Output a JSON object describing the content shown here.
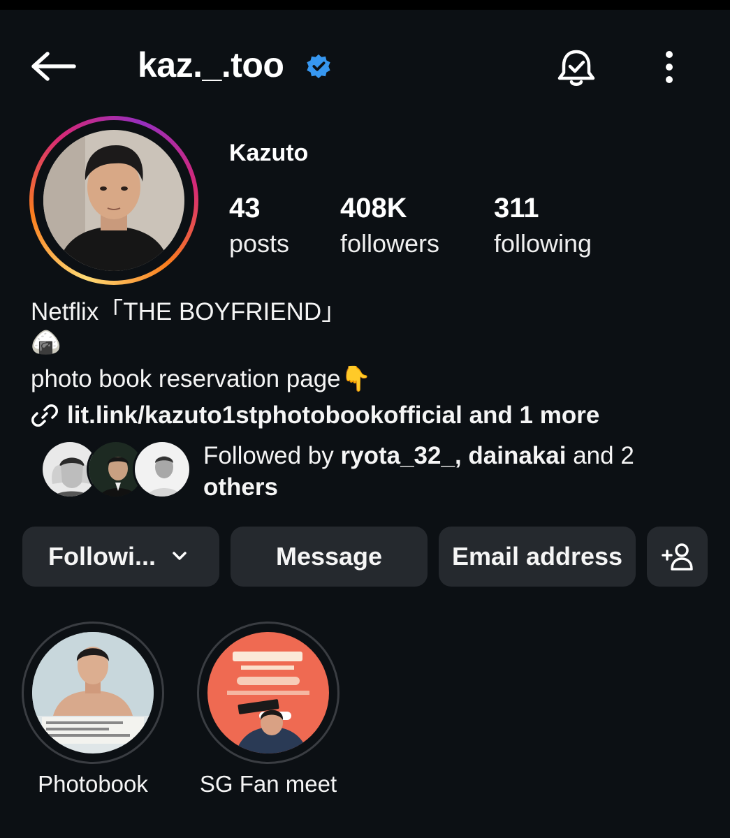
{
  "header": {
    "username": "kaz._.too"
  },
  "profile": {
    "display_name": "Kazuto",
    "stats": [
      {
        "value": "43",
        "label": "posts"
      },
      {
        "value": "408K",
        "label": "followers"
      },
      {
        "value": "311",
        "label": "following"
      }
    ],
    "bio_line1": "Netflix「THE BOYFRIEND」",
    "bio_line2": "🍙",
    "bio_line3": "photo book reservation page👇",
    "link": "lit.link/kazuto1stphotobookofficial and 1 more",
    "followed_by": {
      "prefix": "Followed by ",
      "user1": "ryota_32_",
      "sep": ", ",
      "user2": "dainakai",
      "mid": " and 2 ",
      "suffix": "others"
    }
  },
  "actions": {
    "following": "Followi...",
    "message": "Message",
    "email": "Email address"
  },
  "highlights": [
    {
      "label": "Photobook"
    },
    {
      "label": "SG Fan meet"
    }
  ],
  "colors": {
    "background": "#0c1014",
    "button": "#25292e",
    "verified": "#3797f0"
  },
  "icons": [
    "back-arrow-icon",
    "verified-badge-icon",
    "notification-bell-icon",
    "more-options-icon",
    "link-icon",
    "chevron-down-icon",
    "add-person-icon"
  ]
}
